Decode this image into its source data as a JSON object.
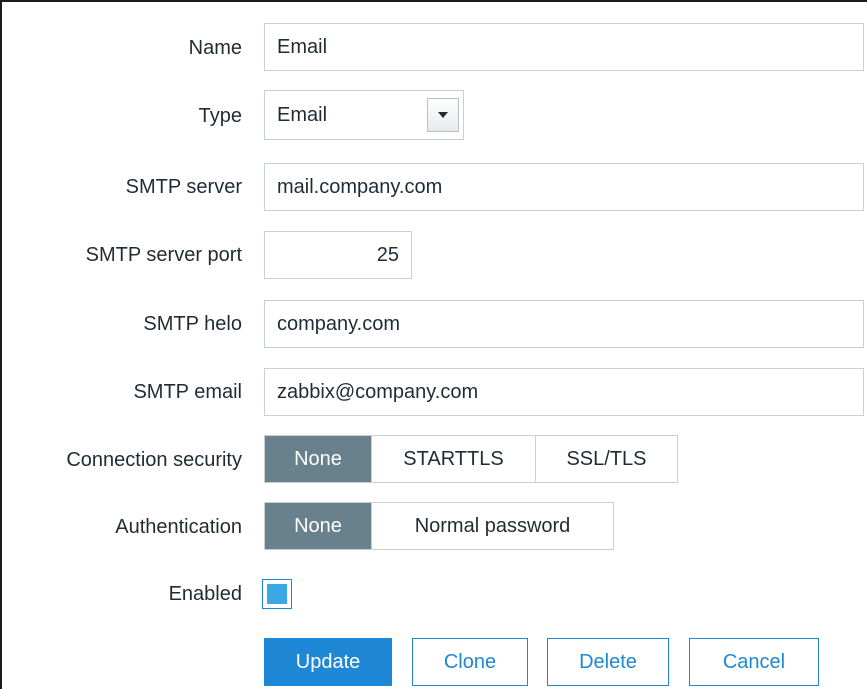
{
  "form": {
    "name": {
      "label": "Name",
      "value": "Email"
    },
    "type": {
      "label": "Type",
      "value": "Email",
      "arrow_icon": "caret-down-icon"
    },
    "smtp_server": {
      "label": "SMTP server",
      "value": "mail.company.com"
    },
    "smtp_server_port": {
      "label": "SMTP server port",
      "value": "25"
    },
    "smtp_helo": {
      "label": "SMTP helo",
      "value": "company.com"
    },
    "smtp_email": {
      "label": "SMTP email",
      "value": "zabbix@company.com"
    },
    "connection_security": {
      "label": "Connection security",
      "options": [
        "None",
        "STARTTLS",
        "SSL/TLS"
      ],
      "selected": "None"
    },
    "authentication": {
      "label": "Authentication",
      "options": [
        "None",
        "Normal password"
      ],
      "selected": "None"
    },
    "enabled": {
      "label": "Enabled",
      "checked": true
    }
  },
  "buttons": {
    "update": "Update",
    "clone": "Clone",
    "delete": "Delete",
    "cancel": "Cancel"
  },
  "colors": {
    "accent": "#1e87d6",
    "segment_active": "#69808d",
    "checkbox_fill": "#3ba8e6"
  }
}
